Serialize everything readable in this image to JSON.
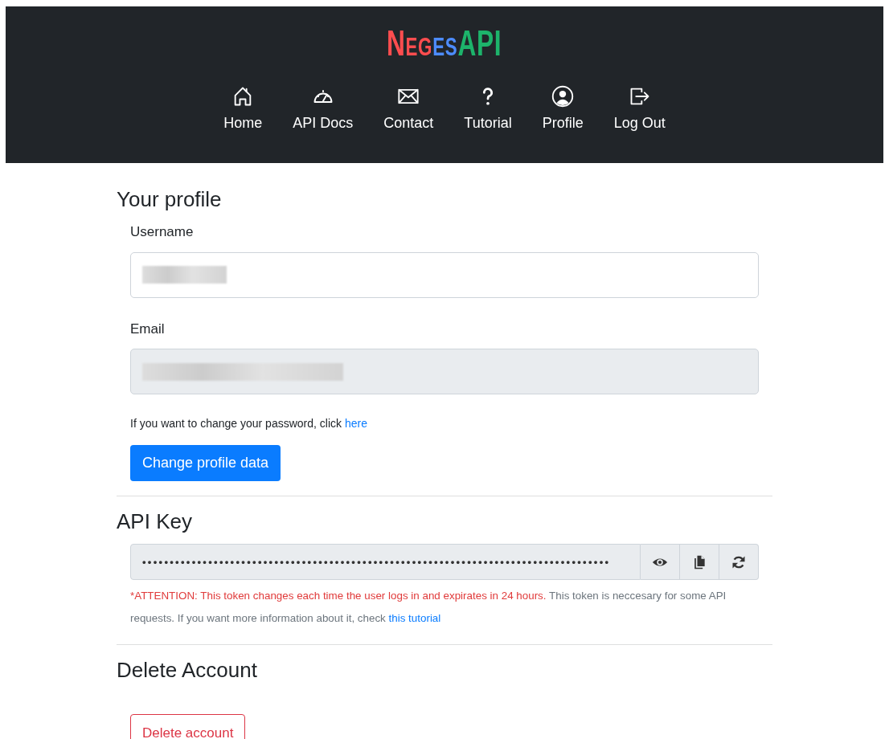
{
  "logo": [
    {
      "text": "Neg",
      "color": "#ff4d4f"
    },
    {
      "text": "es",
      "color": "#4d8cff"
    },
    {
      "text": "API",
      "color": "#1db36b"
    }
  ],
  "nav": [
    {
      "label": "Home"
    },
    {
      "label": "API Docs"
    },
    {
      "label": "Contact"
    },
    {
      "label": "Tutorial"
    },
    {
      "label": "Profile"
    },
    {
      "label": "Log Out"
    }
  ],
  "profile": {
    "title": "Your profile",
    "fields": [
      {
        "label": "Username",
        "redacted": true,
        "disabled": false
      },
      {
        "label": "Email",
        "redacted": true,
        "disabled": true
      }
    ],
    "password_note": {
      "text": "If you want to change your password, click ",
      "link": "here"
    },
    "button": "Change profile data"
  },
  "api_key": {
    "title": "API Key",
    "masked_value": "•••••••••••••••••••••••••••••••••••••••••••••••••••••••••••••••••••••••••••••••••••••",
    "warning": "*ATTENTION: This token changes each time the user logs in and expirates in 24 hours.",
    "note": " This token is neccesary for some API requests. If you want more information about it, check ",
    "link": "this tutorial"
  },
  "delete": {
    "title": "Delete Account",
    "button": "Delete account"
  }
}
